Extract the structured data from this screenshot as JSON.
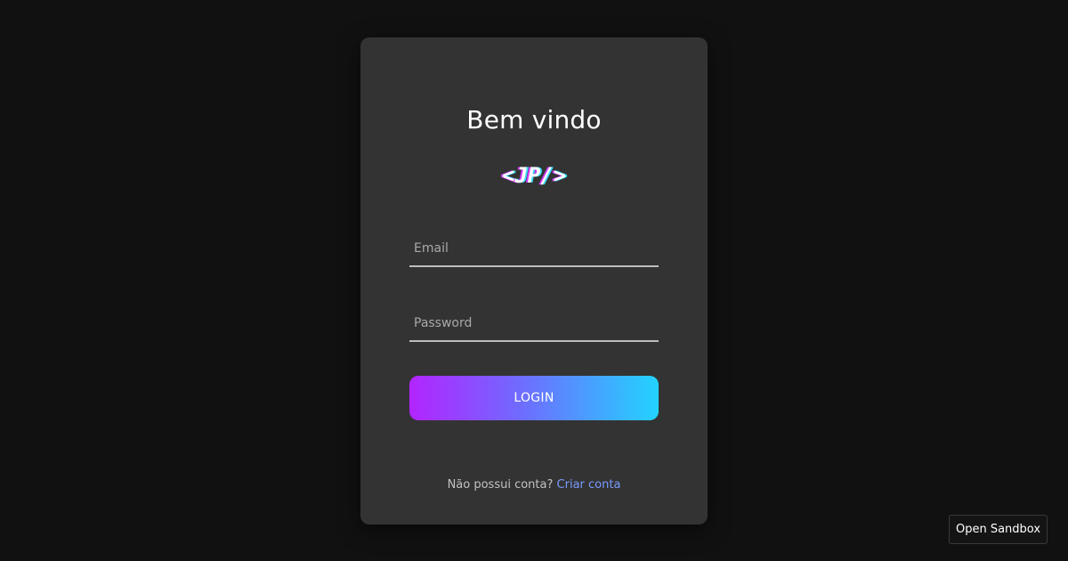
{
  "login_card": {
    "title": "Bem vindo",
    "logo_text": "<JP/>",
    "email": {
      "placeholder": "Email",
      "value": ""
    },
    "password": {
      "placeholder": "Password",
      "value": ""
    },
    "login_button_label": "LOGIN",
    "signup_prompt": "Não possui conta?",
    "signup_link_label": "Criar conta"
  },
  "sandbox_button_label": "Open Sandbox",
  "colors": {
    "background": "#111111",
    "card": "#333333",
    "gradient_start": "#b224ff",
    "gradient_end": "#22d3ff",
    "link": "#7a9bff"
  }
}
